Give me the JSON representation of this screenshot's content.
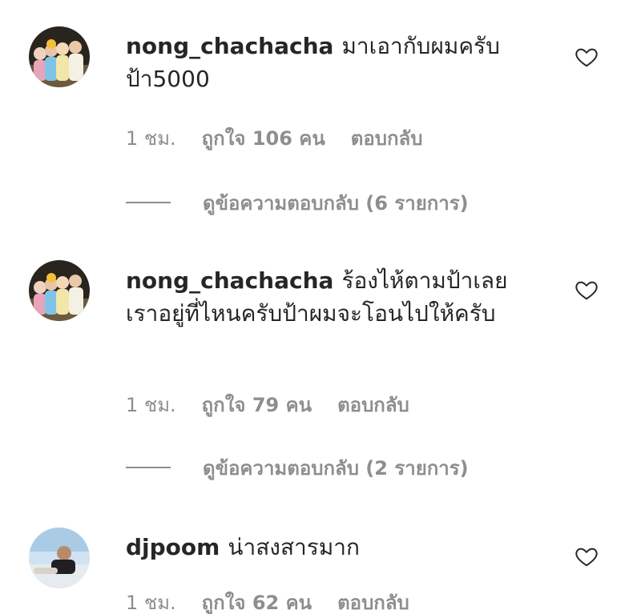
{
  "comments": [
    {
      "username": "nong_chachacha",
      "text": "มาเอากับผมครับป้า5000",
      "time": "1 ชม.",
      "likes": "ถูกใจ 106 คน",
      "reply_label": "ตอบกลับ",
      "view_replies": "ดูข้อความตอบกลับ (6 รายการ)",
      "avatar_icon": "group-photo-avatar"
    },
    {
      "username": "nong_chachacha",
      "text": "ร้องไห้ตามป้าเลย เราอยู่ที่ไหนครับป้าผมจะโอนไปให้ครับ",
      "time": "1 ชม.",
      "likes": "ถูกใจ 79 คน",
      "reply_label": "ตอบกลับ",
      "view_replies": "ดูข้อความตอบกลับ (2 รายการ)",
      "avatar_icon": "group-photo-avatar"
    },
    {
      "username": "djpoom",
      "text": "น่าสงสารมาก",
      "time": "1 ชม.",
      "likes": "ถูกใจ 62 คน",
      "reply_label": "ตอบกลับ",
      "avatar_icon": "person-photo-avatar"
    }
  ],
  "icons": {
    "like": "heart-outline-icon"
  },
  "colors": {
    "text": "#262626",
    "secondary": "#8e8e8e",
    "background": "#ffffff"
  }
}
